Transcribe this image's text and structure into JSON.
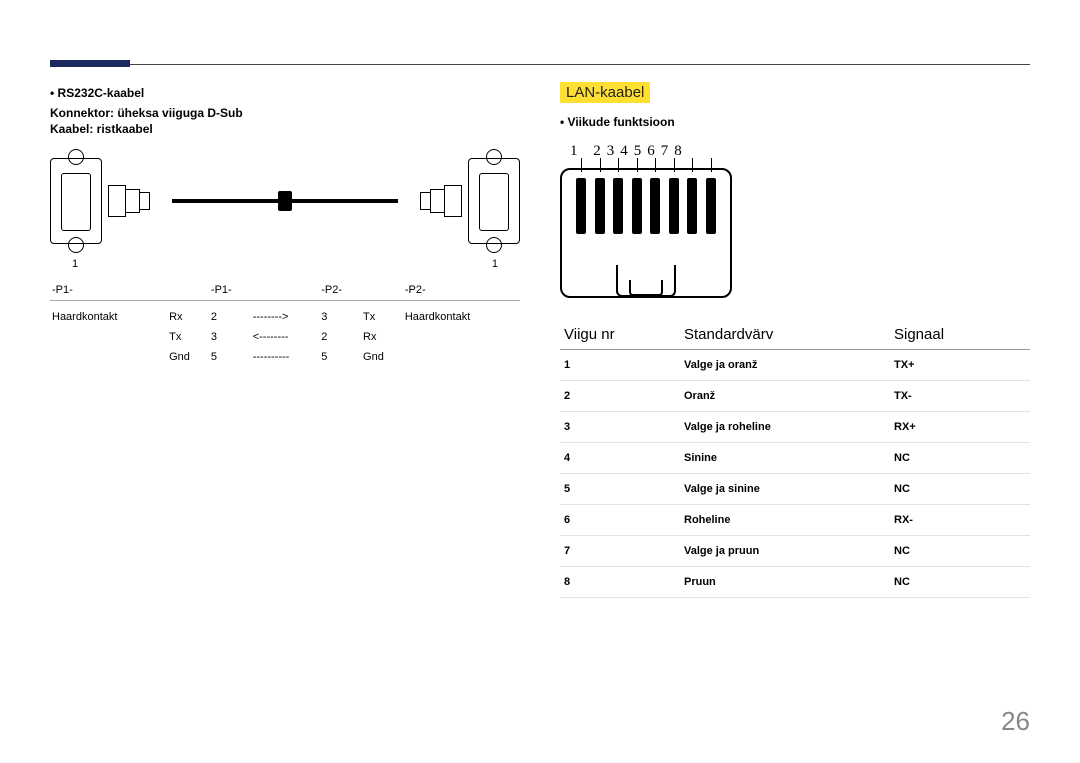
{
  "left": {
    "bullet": "RS232C-kaabel",
    "line1": "Konnektor: üheksa viiguga D-Sub",
    "line2": "Kaabel: ristkaabel",
    "under_left": "1",
    "under_right": "1",
    "pin_headers": [
      "-P1-",
      "-P1-",
      "",
      "-P2-",
      "-P2-"
    ],
    "pin_body": [
      [
        "Haardkontakt",
        "Rx",
        "2",
        "-------->",
        "3",
        "Tx",
        "Haardkontakt"
      ],
      [
        "",
        "Tx",
        "3",
        "<--------",
        "2",
        "Rx",
        ""
      ],
      [
        "",
        "Gnd",
        "5",
        "----------",
        "5",
        "Gnd",
        ""
      ]
    ]
  },
  "right": {
    "section": "LAN-kaabel",
    "bullet": "Viikude funktsioon",
    "pin_numbers": "1 2345678",
    "table_headers": [
      "Viigu nr",
      "Standardvärv",
      "Signaal"
    ],
    "rows": [
      [
        "1",
        "Valge ja oranž",
        "TX+"
      ],
      [
        "2",
        "Oranž",
        "TX-"
      ],
      [
        "3",
        "Valge ja roheline",
        "RX+"
      ],
      [
        "4",
        "Sinine",
        "NC"
      ],
      [
        "5",
        "Valge ja sinine",
        "NC"
      ],
      [
        "6",
        "Roheline",
        "RX-"
      ],
      [
        "7",
        "Valge ja pruun",
        "NC"
      ],
      [
        "8",
        "Pruun",
        "NC"
      ]
    ]
  },
  "page": "26"
}
